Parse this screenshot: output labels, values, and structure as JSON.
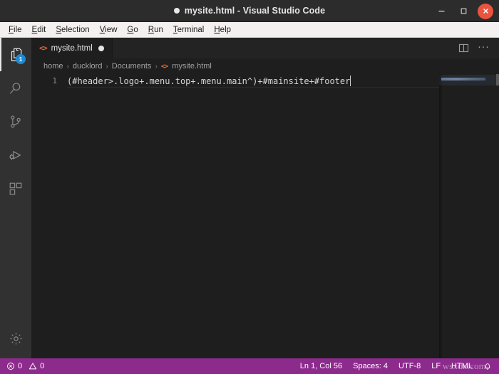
{
  "window": {
    "title": "mysite.html - Visual Studio Code",
    "dirty_indicator": "unsaved-dot",
    "controls": {
      "minimize": "minimize-icon",
      "maximize": "maximize-icon",
      "close": "close-icon",
      "close_color": "#e9543f"
    }
  },
  "menubar": {
    "items": [
      {
        "label": "File",
        "accel": "F"
      },
      {
        "label": "Edit",
        "accel": "E"
      },
      {
        "label": "Selection",
        "accel": "S"
      },
      {
        "label": "View",
        "accel": "V"
      },
      {
        "label": "Go",
        "accel": "G"
      },
      {
        "label": "Run",
        "accel": "R"
      },
      {
        "label": "Terminal",
        "accel": "T"
      },
      {
        "label": "Help",
        "accel": "H"
      }
    ]
  },
  "activitybar": {
    "items": [
      {
        "name": "explorer",
        "icon": "files-icon",
        "badge": "1",
        "active": true
      },
      {
        "name": "search",
        "icon": "search-icon",
        "badge": "",
        "active": false
      },
      {
        "name": "source-control",
        "icon": "git-branch-icon",
        "badge": "",
        "active": false
      },
      {
        "name": "run-debug",
        "icon": "run-debug-icon",
        "badge": "",
        "active": false
      },
      {
        "name": "extensions",
        "icon": "extensions-icon",
        "badge": "",
        "active": false
      }
    ],
    "manage": {
      "name": "manage",
      "icon": "gear-icon"
    },
    "badge_color": "#1f8ad2"
  },
  "tabs": {
    "open": [
      {
        "label": "mysite.html",
        "icon": "html-file-icon",
        "dirty": true,
        "active": true
      }
    ],
    "actions": {
      "split_editor": "split-editor-icon",
      "more_actions": "···"
    }
  },
  "breadcrumbs": {
    "separator": "›",
    "items": [
      {
        "label": "home",
        "icon": ""
      },
      {
        "label": "ducklord",
        "icon": ""
      },
      {
        "label": "Documents",
        "icon": ""
      },
      {
        "label": "mysite.html",
        "icon": "html-file-icon"
      }
    ]
  },
  "editor": {
    "lines": [
      {
        "number": "1",
        "text": "(#header>.logo+.menu.top+.menu.main^)+#mainsite+#footer"
      }
    ],
    "minimap_visible": true
  },
  "statusbar": {
    "background": "#8d2b8d",
    "left": [
      {
        "name": "errors",
        "icon": "error-icon",
        "value": "0"
      },
      {
        "name": "warnings",
        "icon": "warning-icon",
        "value": "0"
      }
    ],
    "right": [
      {
        "name": "cursor-position",
        "label": "Ln 1, Col 56"
      },
      {
        "name": "indentation",
        "label": "Spaces: 4"
      },
      {
        "name": "encoding",
        "label": "UTF-8"
      },
      {
        "name": "eol",
        "label": "LF"
      },
      {
        "name": "language-mode",
        "label": "HTML"
      },
      {
        "name": "notifications",
        "label": "",
        "icon": "bell-icon"
      }
    ]
  },
  "watermark": {
    "text": "wsxdn.com"
  }
}
